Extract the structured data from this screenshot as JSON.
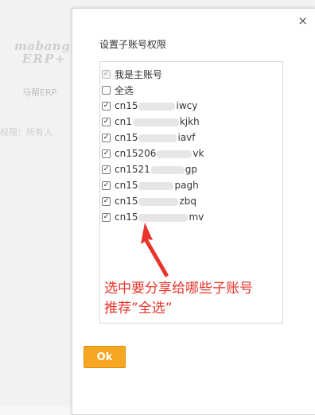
{
  "background": {
    "brand_line1": "mabang",
    "brand_line2": "ERP+",
    "user_name": "马帮ERP",
    "permission_text": "权限：所有人"
  },
  "dialog": {
    "close_glyph": "×",
    "title": "设置子账号权限",
    "items": [
      {
        "pre": "我是主账号",
        "suf": "",
        "checked": true,
        "disabled": true
      },
      {
        "pre": "全选",
        "suf": "",
        "checked": false,
        "disabled": false
      },
      {
        "pre": "cn15",
        "suf": "iwcy",
        "checked": true
      },
      {
        "pre": "cn1",
        "suf": "kjkh",
        "checked": true
      },
      {
        "pre": "cn15",
        "suf": "iavf",
        "checked": true
      },
      {
        "pre": "cn15206",
        "suf": "vk",
        "checked": true
      },
      {
        "pre": "cn1521",
        "suf": "gp",
        "checked": true
      },
      {
        "pre": "cn15",
        "suf": "pagh",
        "checked": true
      },
      {
        "pre": "cn15",
        "suf": "zbq",
        "checked": true
      },
      {
        "pre": "cn15",
        "suf": "mv",
        "checked": true
      }
    ],
    "annotation_line1": "选中要分享给哪些子账号",
    "annotation_line2": "推荐”全选”",
    "ok_label": "Ok"
  },
  "colors": {
    "accent": "#f5a623",
    "annotation": "#e8342a"
  }
}
